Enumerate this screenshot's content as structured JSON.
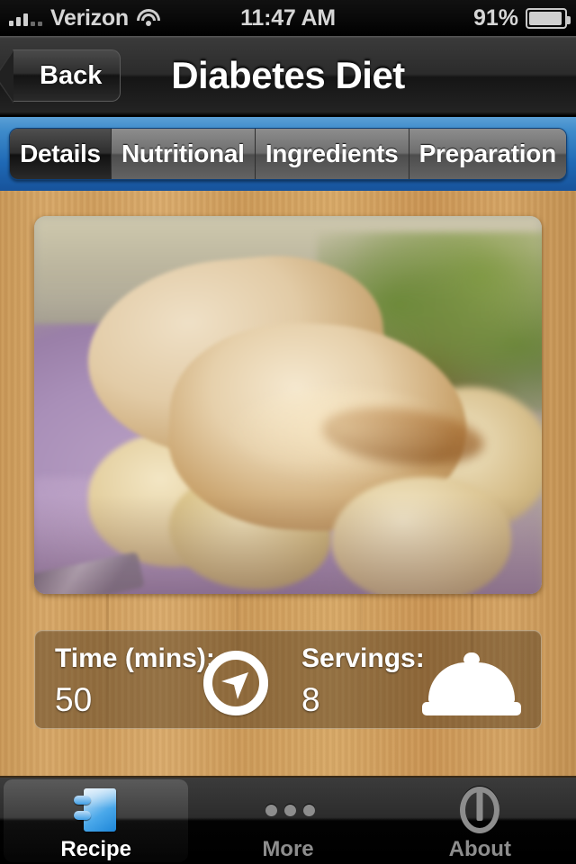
{
  "statusbar": {
    "carrier": "Verizon",
    "signal_icon": "signal-bars-icon",
    "wifi_icon": "wifi-icon",
    "time": "11:47 AM",
    "battery_percent": "91%",
    "battery_icon": "battery-icon"
  },
  "navbar": {
    "back_label": "Back",
    "title": "Diabetes Diet"
  },
  "segments": [
    {
      "label": "Details",
      "selected": true
    },
    {
      "label": "Nutritional",
      "selected": false
    },
    {
      "label": "Ingredients",
      "selected": false
    },
    {
      "label": "Preparation",
      "selected": false
    }
  ],
  "recipe_photo": {
    "alt": "Baked chicken with potatoes and onions on a lavender plate"
  },
  "info_panel": {
    "time_label": "Time (mins):",
    "time_value": "50",
    "time_icon": "compass-clock-icon",
    "servings_label": "Servings:",
    "servings_value": "8",
    "servings_icon": "cloche-icon"
  },
  "tabbar": [
    {
      "label": "Recipe",
      "icon": "notebook-icon",
      "selected": true
    },
    {
      "label": "More",
      "icon": "ellipsis-icon",
      "selected": false
    },
    {
      "label": "About",
      "icon": "info-circle-icon",
      "selected": false
    }
  ],
  "colors": {
    "segment_bar_blue": "#2f7cc2",
    "wood_background": "#cf9e5e",
    "accent_blue": "#4aa8ea",
    "tab_inactive": "#8d8d8d"
  }
}
